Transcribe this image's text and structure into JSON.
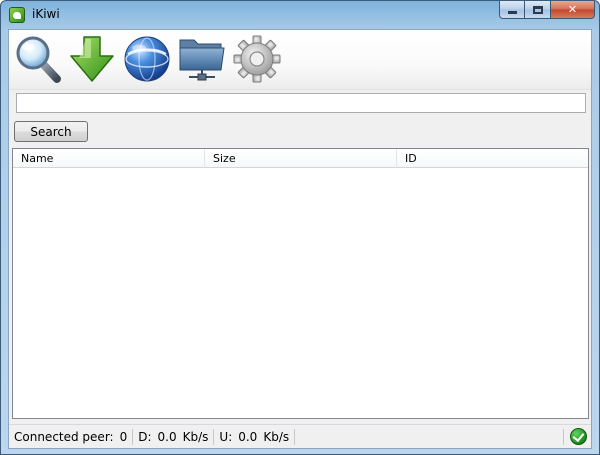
{
  "window": {
    "title": "iKiwi",
    "controls": {
      "minimize_icon": "minimize-icon",
      "maximize_icon": "maximize-icon",
      "close_glyph": "✕"
    }
  },
  "toolbar": {
    "items": [
      {
        "icon": "search-icon"
      },
      {
        "icon": "download-icon"
      },
      {
        "icon": "network-globe-icon"
      },
      {
        "icon": "shared-folder-icon"
      },
      {
        "icon": "settings-gear-icon"
      }
    ]
  },
  "search": {
    "value": "",
    "placeholder": "",
    "button_label": "Search"
  },
  "results": {
    "columns": [
      "Name",
      "Size",
      "ID"
    ],
    "rows": []
  },
  "status": {
    "connected_peer_label": "Connected peer:",
    "connected_peer_value": "0",
    "download_label": "D:",
    "download_value": "0.0",
    "download_unit": "Kb/s",
    "upload_label": "U:",
    "upload_value": "0.0",
    "upload_unit": "Kb/s",
    "connection_icon": "connected-check-icon"
  },
  "colors": {
    "title_bar": "#a9cbe8",
    "close_button": "#c2452a",
    "status_ok": "#1b8a1b"
  }
}
